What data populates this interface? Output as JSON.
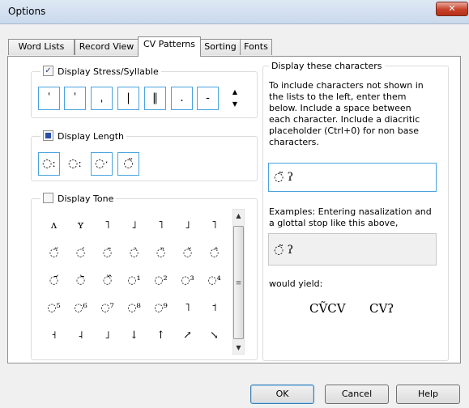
{
  "window": {
    "title": "Options",
    "close_glyph": "✕"
  },
  "tabs": [
    "Word Lists",
    "Record View",
    "CV Patterns",
    "Sorting",
    "Fonts"
  ],
  "active_tab": "CV Patterns",
  "stress": {
    "label": "Display Stress/Syllable",
    "checked": true,
    "check_glyph": "✓",
    "symbols": [
      "ˈ",
      "ˈ",
      "ˌ",
      "|",
      "‖",
      ".",
      "-"
    ]
  },
  "length": {
    "label": "Display Length",
    "state": "indeterminate",
    "symbols": [
      "◌ː",
      "◌ː",
      "◌ˑ",
      "◌̆"
    ]
  },
  "tone": {
    "label": "Display Tone",
    "checked": false,
    "rows": [
      [
        "ʌ",
        "ʏ",
        "˥",
        "˩",
        "˥",
        "˩",
        "˥"
      ],
      [
        "◌̋",
        "◌́",
        "◌̄",
        "◌̀",
        "◌̏",
        "◌̌",
        "◌̂"
      ],
      [
        "◌᷄",
        "◌᷅",
        "◌᷈",
        "◌¹",
        "◌²",
        "◌³",
        "◌⁴"
      ],
      [
        "◌⁵",
        "◌⁶",
        "◌⁷",
        "◌⁸",
        "◌⁹",
        "˥",
        "˦"
      ],
      [
        "˧",
        "˨",
        "˩",
        "↓",
        "↑",
        "↗",
        "↘"
      ]
    ],
    "scroll_grip": "≡",
    "scroll_up": "▲",
    "scroll_down": "▼"
  },
  "display_chars": {
    "label": "Display these characters",
    "instructions": [
      "To include characters not shown in",
      "the lists to the left, enter them",
      "below. Include a space between",
      "each character. Include a diacritic",
      "placeholder (Ctrl+0) for non base",
      "characters."
    ],
    "input_value": "◌̃ ʔ",
    "examples": [
      "Examples: Entering nasalization and",
      "a glottal stop like this above,"
    ],
    "example_value": "◌̃ ʔ",
    "yield_label": "would yield:",
    "yield_1": "CṼCV",
    "yield_2": "CVʔ"
  },
  "buttons": {
    "ok": "OK",
    "cancel": "Cancel",
    "help": "Help"
  }
}
